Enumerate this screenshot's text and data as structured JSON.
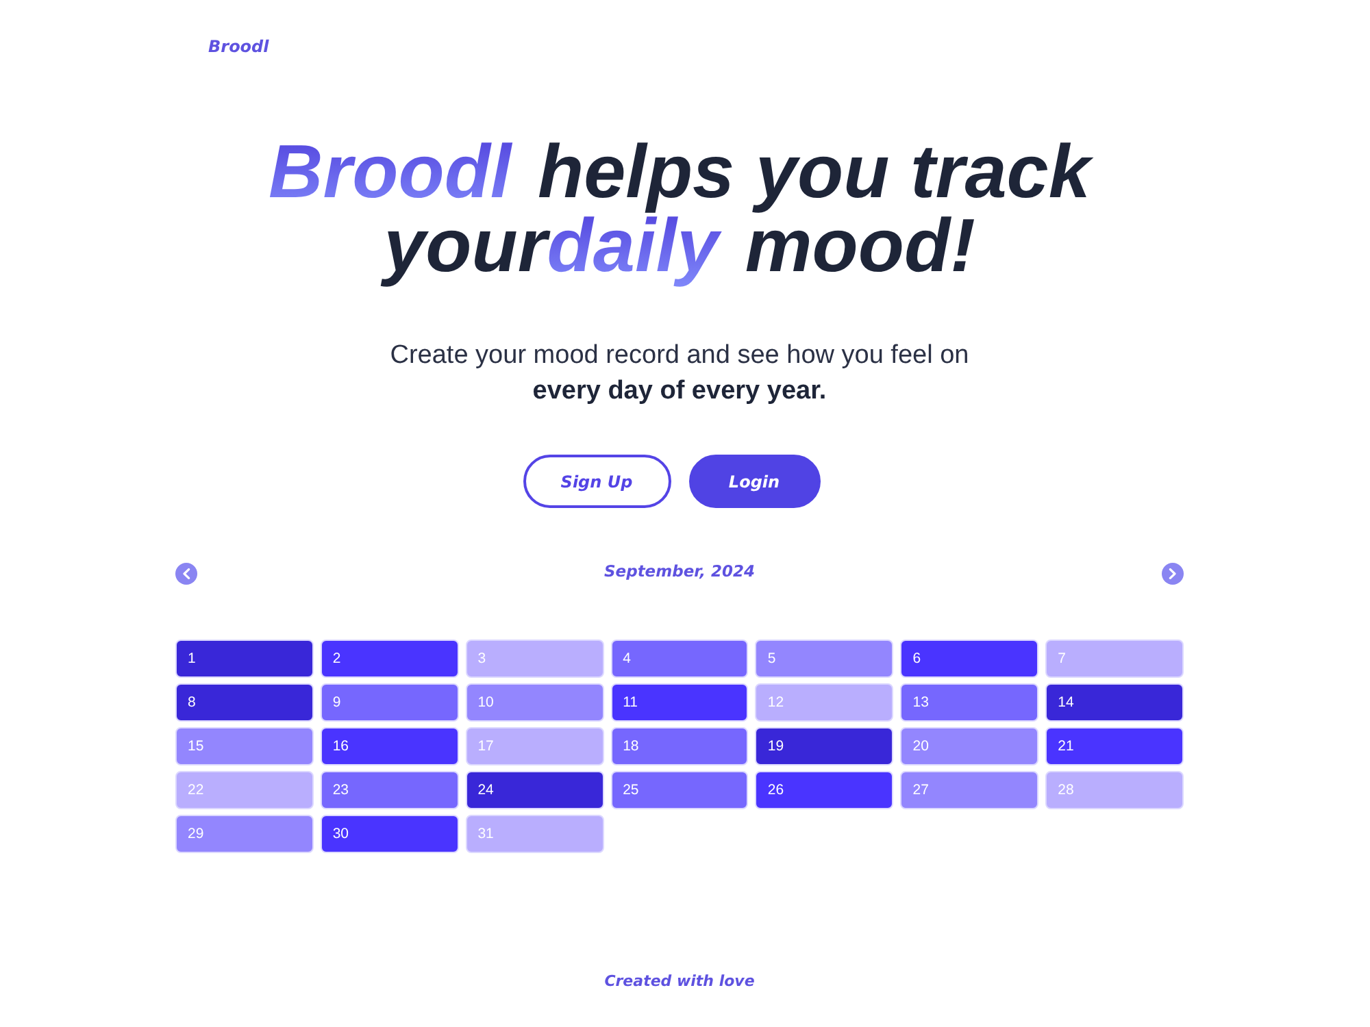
{
  "logo": "Broodl",
  "hero": {
    "title_lines": [
      {
        "segments": [
          {
            "text": "Broodl",
            "accent": true
          },
          {
            "text": " helps you track",
            "accent": false
          }
        ]
      },
      {
        "segments": [
          {
            "text": "your",
            "accent": false
          },
          {
            "text": "daily",
            "accent": true
          },
          {
            "text": " mood!",
            "accent": false
          }
        ]
      }
    ],
    "subtitle": "Create your mood record and see how you feel on **every day of every year.**",
    "buttons": [
      {
        "label": "Sign Up",
        "kind": "outline"
      },
      {
        "label": "Login",
        "kind": "filled"
      }
    ]
  },
  "calendar": {
    "month": "September, 2024",
    "days": [
      {
        "label": "1",
        "color": "#3927d8"
      },
      {
        "label": "2",
        "color": "#4a34ff"
      },
      {
        "label": "3",
        "color": "#b9aefe"
      },
      {
        "label": "4",
        "color": "#7667fe"
      },
      {
        "label": "5",
        "color": "#9386fe"
      },
      {
        "label": "6",
        "color": "#4a34ff"
      },
      {
        "label": "7",
        "color": "#b9aefe"
      },
      {
        "label": "8",
        "color": "#3927d8"
      },
      {
        "label": "9",
        "color": "#7667fe"
      },
      {
        "label": "10",
        "color": "#9386fe"
      },
      {
        "label": "11",
        "color": "#4a34ff"
      },
      {
        "label": "12",
        "color": "#b9aefe"
      },
      {
        "label": "13",
        "color": "#7667fe"
      },
      {
        "label": "14",
        "color": "#3927d8"
      },
      {
        "label": "15",
        "color": "#9386fe"
      },
      {
        "label": "16",
        "color": "#4a34ff"
      },
      {
        "label": "17",
        "color": "#b9aefe"
      },
      {
        "label": "18",
        "color": "#7667fe"
      },
      {
        "label": "19",
        "color": "#3927d8"
      },
      {
        "label": "20",
        "color": "#9386fe"
      },
      {
        "label": "21",
        "color": "#4a34ff"
      },
      {
        "label": "22",
        "color": "#b9aefe"
      },
      {
        "label": "23",
        "color": "#7667fe"
      },
      {
        "label": "24",
        "color": "#3927d8"
      },
      {
        "label": "25",
        "color": "#7667fe"
      },
      {
        "label": "26",
        "color": "#4a34ff"
      },
      {
        "label": "27",
        "color": "#9386fe"
      },
      {
        "label": "28",
        "color": "#b9aefe"
      },
      {
        "label": "29",
        "color": "#9386fe"
      },
      {
        "label": "30",
        "color": "#4a34ff"
      },
      {
        "label": "31",
        "color": "#b9aefe"
      }
    ]
  },
  "footer": "Created with love"
}
